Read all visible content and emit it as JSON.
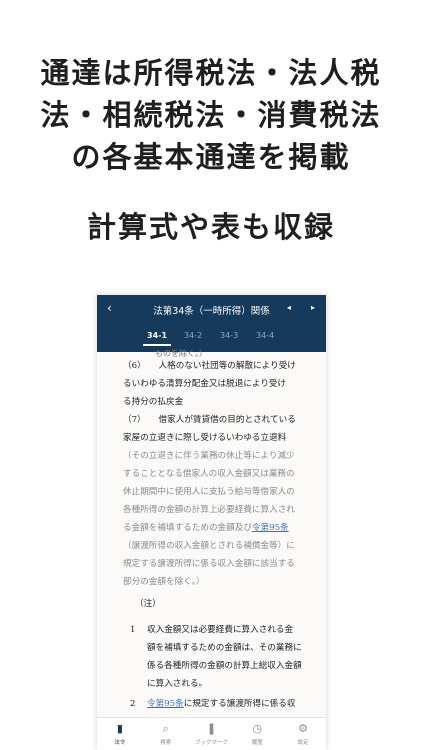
{
  "headline": {
    "lines": [
      "通達は所得税法・法人税",
      "法・相続税法・消費税法",
      "の各基本通達を掲載"
    ],
    "subline": "計算式や表も収録"
  },
  "navbar": {
    "back_glyph": "‹",
    "title": "法第34条（一時所得）関係",
    "prev_glyph": "◂",
    "next_glyph": "▸"
  },
  "tabs": [
    {
      "label": "34-1",
      "active": true
    },
    {
      "label": "34-2",
      "active": false
    },
    {
      "label": "34-3",
      "active": false
    },
    {
      "label": "34-4",
      "active": false
    }
  ],
  "content": {
    "cut_line": "ものを除く。）",
    "item6": {
      "num": "（6）",
      "lines": [
        "　　人格のない社団等の解散により受け",
        "るいわゆる清算分配金又は脱退により受け",
        "る持分の払戻金"
      ]
    },
    "item7": {
      "num": "（7）",
      "lines": [
        "　　借家人が賃貸借の目的とされている",
        "家屋の立退きに際し受けるいわゆる立退料"
      ],
      "muted_lines": [
        "（その立退きに伴う業務の休止等により減少",
        "することとなる借家人の収入金額又は業務の",
        "休止期間中に使用人に支払う給与等借家人の",
        "各種所得の金額の計算上必要経費に算入され",
        "る金額を補填するための金額及び"
      ],
      "link1": "令第95条",
      "muted_after": [
        "（譲渡所得の収入金額とされる補償金等）に",
        "規定する譲渡所得に係る収入金額に該当する",
        "部分の金額を除く。）"
      ]
    },
    "note_head": "（注）",
    "note1": {
      "num": "1",
      "lines": [
        "収入金額又は必要経費に算入される金",
        "額を補填するための金額は、その業務に",
        "係る各種所得の金額の計算上総収入金額",
        "に算入される。"
      ]
    },
    "note2": {
      "num": "2",
      "link": "令第95条",
      "rest": "に規定する譲渡所得に係る収"
    }
  },
  "tabbar": [
    {
      "label": "法令",
      "icon": "book-icon",
      "glyph": "▮",
      "active": true
    },
    {
      "label": "検索",
      "icon": "search-icon",
      "glyph": "⌕",
      "active": false
    },
    {
      "label": "ブックマーク",
      "icon": "bookmark-icon",
      "glyph": "❚",
      "active": false
    },
    {
      "label": "履歴",
      "icon": "history-icon",
      "glyph": "◷",
      "active": false
    },
    {
      "label": "設定",
      "icon": "gear-icon",
      "glyph": "⚙",
      "active": false
    }
  ],
  "colors": {
    "nav_bg": "#163a5c",
    "link": "#3a73c6",
    "muted_text": "#8a8a8a"
  }
}
